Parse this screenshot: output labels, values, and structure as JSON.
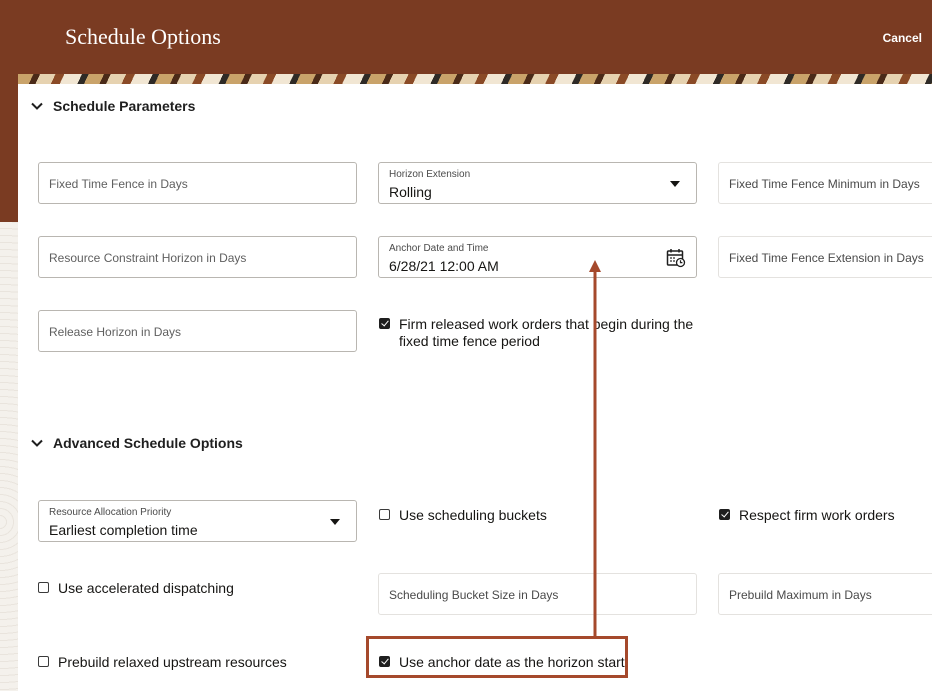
{
  "header": {
    "title": "Schedule Options",
    "cancel_label": "Cancel"
  },
  "sections": {
    "parameters": {
      "title": "Schedule Parameters"
    },
    "advanced": {
      "title": "Advanced Schedule Options"
    }
  },
  "fields": {
    "fixed_time_fence": {
      "placeholder": "Fixed Time Fence in Days"
    },
    "horizon_extension": {
      "label": "Horizon Extension",
      "value": "Rolling"
    },
    "fixed_time_fence_min": {
      "placeholder": "Fixed Time Fence Minimum in Days"
    },
    "resource_constraint_horizon": {
      "placeholder": "Resource Constraint Horizon in Days"
    },
    "anchor_date": {
      "label": "Anchor Date and Time",
      "value": "6/28/21 12:00 AM"
    },
    "fixed_time_fence_ext": {
      "placeholder": "Fixed Time Fence Extension in Days"
    },
    "release_horizon": {
      "placeholder": "Release Horizon in Days"
    },
    "resource_allocation_priority": {
      "label": "Resource Allocation Priority",
      "value": "Earliest completion time"
    },
    "scheduling_bucket_size": {
      "placeholder": "Scheduling Bucket Size in Days"
    },
    "prebuild_max": {
      "placeholder": "Prebuild Maximum in Days"
    }
  },
  "checkboxes": {
    "firm_released": {
      "label_line1": "Firm released work orders that begin during the",
      "label_line2": "fixed time fence period",
      "checked": true
    },
    "use_scheduling_buckets": {
      "label": "Use scheduling buckets",
      "checked": false
    },
    "respect_firm": {
      "label": "Respect firm work orders",
      "checked": true
    },
    "accelerated_dispatching": {
      "label": "Use accelerated dispatching",
      "checked": false
    },
    "prebuild_relaxed": {
      "label": "Prebuild relaxed upstream resources",
      "checked": false
    },
    "anchor_as_horizon_start": {
      "label": "Use anchor date as the horizon start",
      "checked": true
    }
  },
  "colors": {
    "header_bg": "#7a3b22",
    "annotation": "#a5492c"
  },
  "icons": {
    "section_toggle": "chevron-down-icon",
    "date_picker": "calendar-icon",
    "dropdown": "caret-down-icon"
  }
}
